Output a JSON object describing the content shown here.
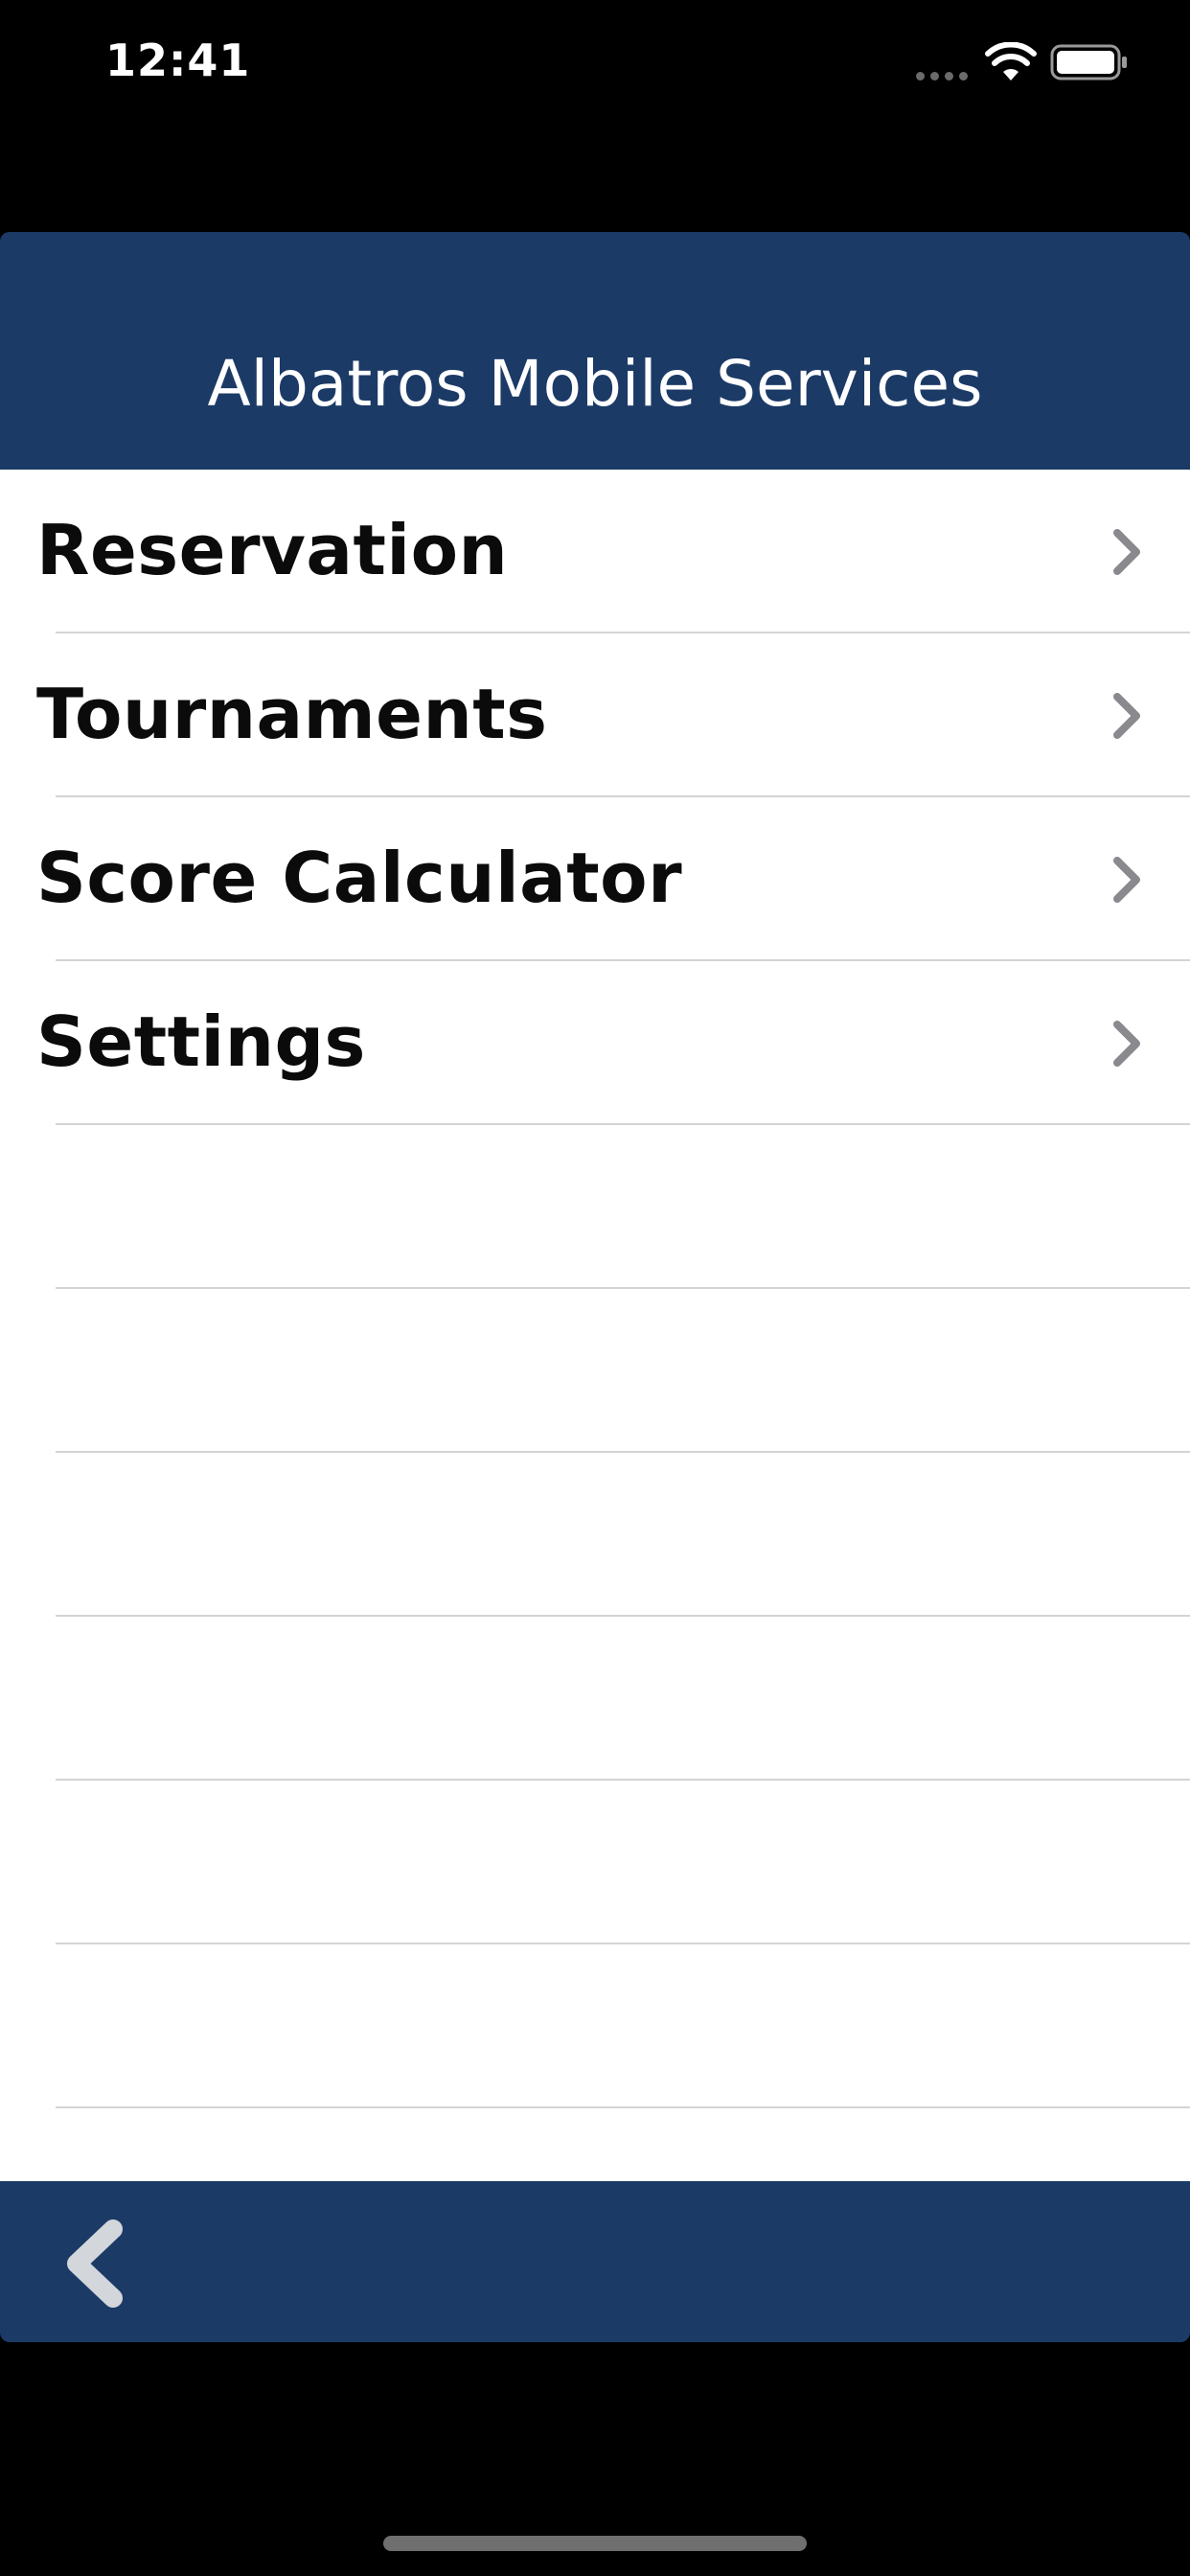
{
  "status_bar": {
    "time": "12:41"
  },
  "header": {
    "title": "Albatros Mobile Services"
  },
  "menu": {
    "items": [
      {
        "label": "Reservation",
        "icon": "chevron-right-icon"
      },
      {
        "label": "Tournaments",
        "icon": "chevron-right-icon"
      },
      {
        "label": "Score Calculator",
        "icon": "chevron-right-icon"
      },
      {
        "label": "Settings",
        "icon": "chevron-right-icon"
      }
    ]
  },
  "toolbar": {
    "back_icon": "chevron-left-icon"
  },
  "colors": {
    "brand_navy": "#1b3a66",
    "background": "#000000",
    "list_background": "#ffffff",
    "separator": "#d4d4d6",
    "chevron": "#8a8a8e"
  }
}
